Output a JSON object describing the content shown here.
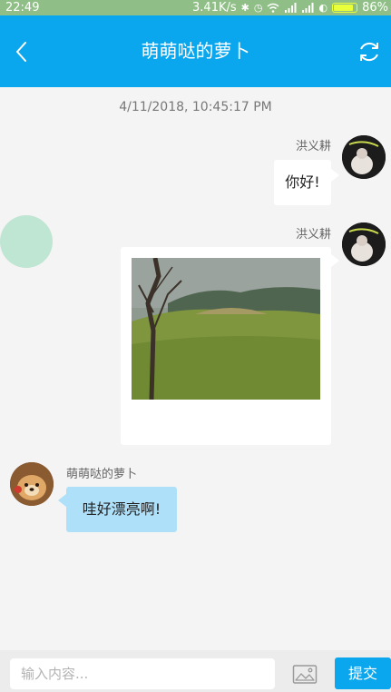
{
  "status_bar": {
    "time": "22:49",
    "network_speed": "3.41K/s",
    "battery": "86%",
    "icons": [
      "bluetooth-icon",
      "alarm-icon",
      "wifi-icon",
      "signal-icon",
      "signal-icon",
      "data-saver-icon",
      "battery-icon"
    ]
  },
  "header": {
    "title": "萌萌哒的萝卜",
    "back_icon": "chevron-left-icon",
    "refresh_icon": "refresh-icon"
  },
  "conversation": {
    "timestamp": "4/11/2018, 10:45:17 PM",
    "messages": [
      {
        "sender": "洪义耕",
        "side": "right",
        "type": "text",
        "text": "你好!"
      },
      {
        "sender": "洪义耕",
        "side": "right",
        "type": "image",
        "image_icon": "photo-grass-field"
      },
      {
        "sender": "萌萌哒的萝卜",
        "side": "left",
        "type": "text",
        "text": "哇好漂亮啊!"
      }
    ]
  },
  "composer": {
    "placeholder": "输入内容...",
    "image_icon": "image-icon",
    "submit_label": "提交"
  },
  "colors": {
    "status_bar": "#8fbf86",
    "header": "#0aa6ee",
    "background": "#f4f4f4",
    "incoming_bubble": "#aee0fa",
    "outgoing_bubble": "#ffffff",
    "submit_button": "#0aa6ee"
  }
}
